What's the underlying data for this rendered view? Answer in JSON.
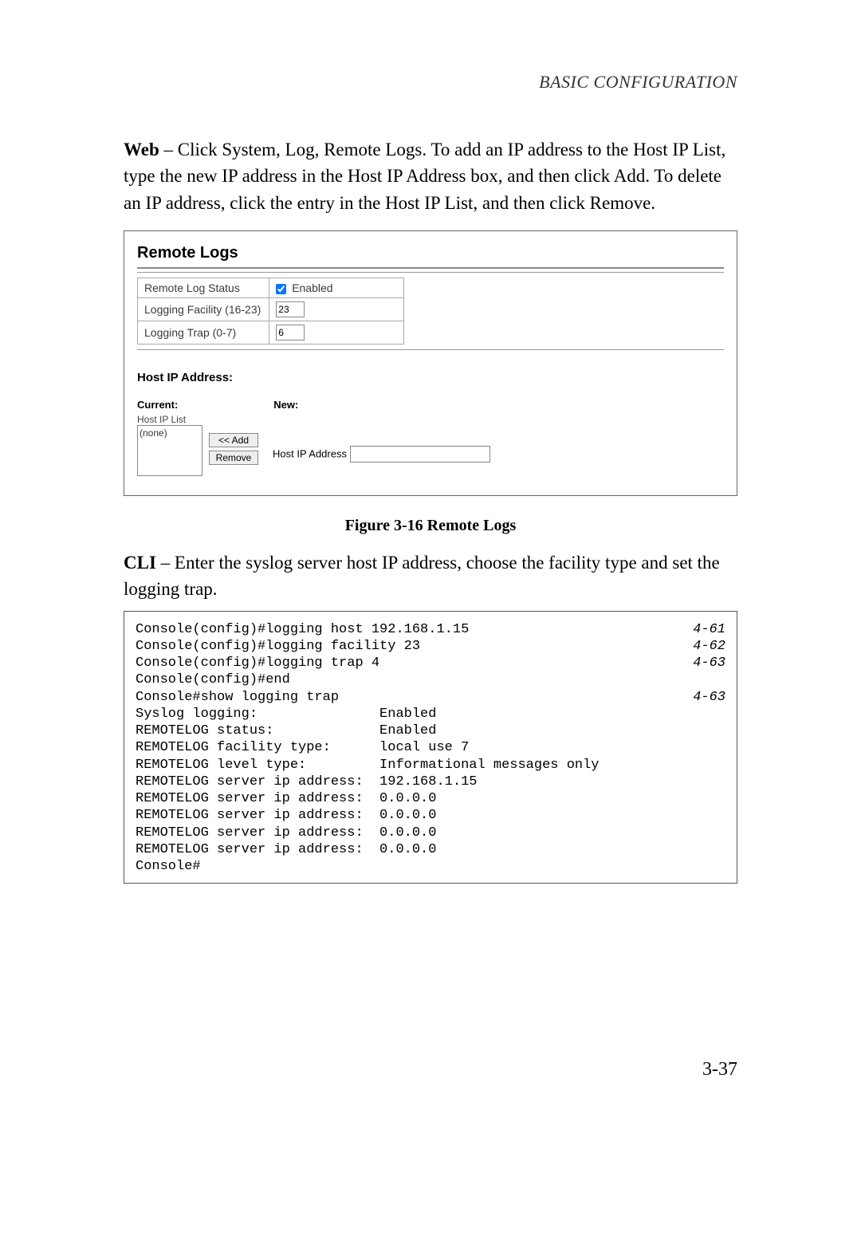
{
  "header": {
    "running": "BASIC CONFIGURATION"
  },
  "paragraphs": {
    "web_label": "Web",
    "web_text": " – Click System, Log, Remote Logs. To add an IP address to the Host IP List, type the new IP address in the Host IP Address box, and then click Add. To delete an IP address, click the entry in the Host IP List, and then click Remove.",
    "cli_label": "CLI",
    "cli_text": " – Enter the syslog server host IP address, choose the facility type and set the logging trap."
  },
  "figure": {
    "title": "Remote Logs",
    "rows": {
      "status_label": "Remote Log Status",
      "status_chk_label": "Enabled",
      "status_checked": true,
      "facility_label": "Logging Facility (16-23)",
      "facility_value": "23",
      "trap_label": "Logging Trap (0-7)",
      "trap_value": "6"
    },
    "hostip": {
      "heading": "Host IP Address:",
      "current_label": "Current:",
      "new_label": "New:",
      "list_label": "Host IP List",
      "list_placeholder": "(none)",
      "add_btn": "<< Add",
      "remove_btn": "Remove",
      "new_field_label": "Host IP Address",
      "new_field_value": ""
    },
    "caption": "Figure 3-16  Remote Logs"
  },
  "cli": {
    "lines": [
      {
        "text": "Console(config)#logging host 192.168.1.15",
        "ref": "4-61"
      },
      {
        "text": "Console(config)#logging facility 23",
        "ref": "4-62"
      },
      {
        "text": "Console(config)#logging trap 4",
        "ref": "4-63"
      },
      {
        "text": "Console(config)#end",
        "ref": ""
      },
      {
        "text": "Console#show logging trap",
        "ref": "4-63"
      },
      {
        "text": "Syslog logging:               Enabled",
        "ref": ""
      },
      {
        "text": "REMOTELOG status:             Enabled",
        "ref": ""
      },
      {
        "text": "REMOTELOG facility type:      local use 7",
        "ref": ""
      },
      {
        "text": "REMOTELOG level type:         Informational messages only",
        "ref": ""
      },
      {
        "text": "REMOTELOG server ip address:  192.168.1.15",
        "ref": ""
      },
      {
        "text": "REMOTELOG server ip address:  0.0.0.0",
        "ref": ""
      },
      {
        "text": "REMOTELOG server ip address:  0.0.0.0",
        "ref": ""
      },
      {
        "text": "REMOTELOG server ip address:  0.0.0.0",
        "ref": ""
      },
      {
        "text": "REMOTELOG server ip address:  0.0.0.0",
        "ref": ""
      },
      {
        "text": "Console#",
        "ref": ""
      }
    ]
  },
  "page_number": "3-37"
}
